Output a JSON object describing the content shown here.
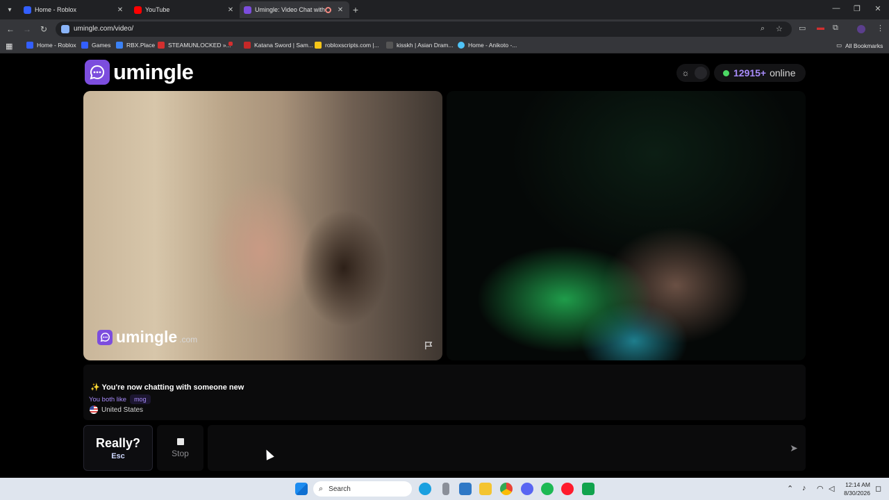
{
  "browser": {
    "tabs": [
      {
        "title": "Home - Roblox",
        "favicon_color": "#335fff",
        "active": false
      },
      {
        "title": "YouTube",
        "favicon_color": "#ff0000",
        "active": false
      },
      {
        "title": "Umingle: Video Chat with S",
        "favicon_color": "#7c4dde",
        "active": true
      }
    ],
    "url": "umingle.com/video/",
    "bookmarks": [
      {
        "label": "Home - Roblox",
        "color": "#335fff"
      },
      {
        "label": "Games",
        "color": "#335fff"
      },
      {
        "label": "RBX.Place",
        "color": "#3b82f6"
      },
      {
        "label": "STEAMUNLOCKED »...",
        "color": "#d32f2f"
      },
      {
        "label": "",
        "color": "#d32f2f"
      },
      {
        "label": "Katana Sword | Sam...",
        "color": "#c62828"
      },
      {
        "label": "robloxscripts.com |...",
        "color": "#f5c518"
      },
      {
        "label": "kisskh | Asian Dram...",
        "color": "#555555"
      },
      {
        "label": "Home - Anikoto -...",
        "color": "#4fc3f7"
      }
    ],
    "all_bookmarks_label": "All Bookmarks"
  },
  "site": {
    "logo_text": "umingle",
    "accent": "#7c4dde",
    "online_count": "12915+",
    "online_label": "online",
    "watermark_text": "umingle",
    "watermark_tld": ".com"
  },
  "chat_info": {
    "title": "✨ You're now chatting with someone new",
    "likes_prefix": "You both like",
    "likes_tag": "mog",
    "country": "United States"
  },
  "controls": {
    "esc_main": "Really?",
    "esc_sub": "Esc",
    "stop_label": "Stop",
    "input_value": ""
  },
  "taskbar": {
    "search_placeholder": "Search",
    "time": "12:14 AM",
    "date": "8/30/2026"
  }
}
